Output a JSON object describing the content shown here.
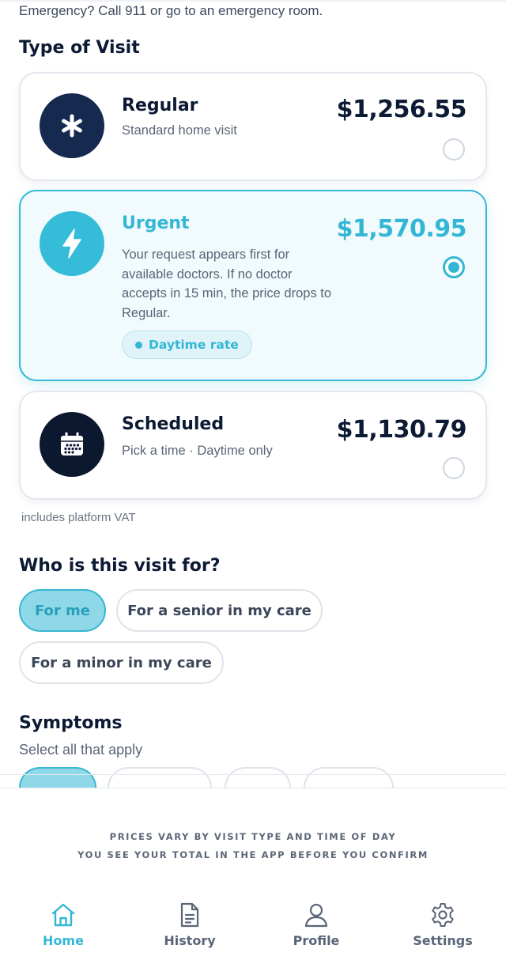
{
  "emergency_text": "Emergency? Call 911 or go to an emergency room.",
  "type_of_visit": {
    "title": "Type of Visit",
    "options": [
      {
        "name": "Regular",
        "description": "Standard home visit",
        "price": "$1,256.55",
        "selected": false,
        "icon": "asterisk-icon"
      },
      {
        "name": "Urgent",
        "description": "Your request appears first for available doctors. If no doctor accepts in 15 min, the price drops to Regular.",
        "price": "$1,570.95",
        "selected": true,
        "icon": "lightning-icon",
        "badge": "Daytime rate"
      },
      {
        "name": "Scheduled",
        "description": "Pick a time · Daytime only",
        "price": "$1,130.79",
        "selected": false,
        "icon": "calendar-icon"
      }
    ],
    "vat_note": "includes platform VAT"
  },
  "who_for": {
    "title": "Who is this visit for?",
    "options": [
      {
        "label": "For me",
        "selected": true
      },
      {
        "label": "For a senior in my care",
        "selected": false
      },
      {
        "label": "For a minor in my care",
        "selected": false
      }
    ]
  },
  "symptoms": {
    "title": "Symptoms",
    "subtitle": "Select all that apply"
  },
  "footer_notes": [
    "PRICES VARY BY VISIT TYPE AND TIME OF DAY",
    "YOU SEE YOUR TOTAL IN THE APP BEFORE YOU CONFIRM"
  ],
  "tabs": [
    {
      "label": "Home",
      "icon": "home-icon",
      "active": true
    },
    {
      "label": "History",
      "icon": "document-icon",
      "active": false
    },
    {
      "label": "Profile",
      "icon": "person-icon",
      "active": false
    },
    {
      "label": "Settings",
      "icon": "gear-icon",
      "active": false
    }
  ],
  "colors": {
    "accent": "#33b7d4",
    "navy": "#162a4f",
    "text": "#0d1a33"
  }
}
